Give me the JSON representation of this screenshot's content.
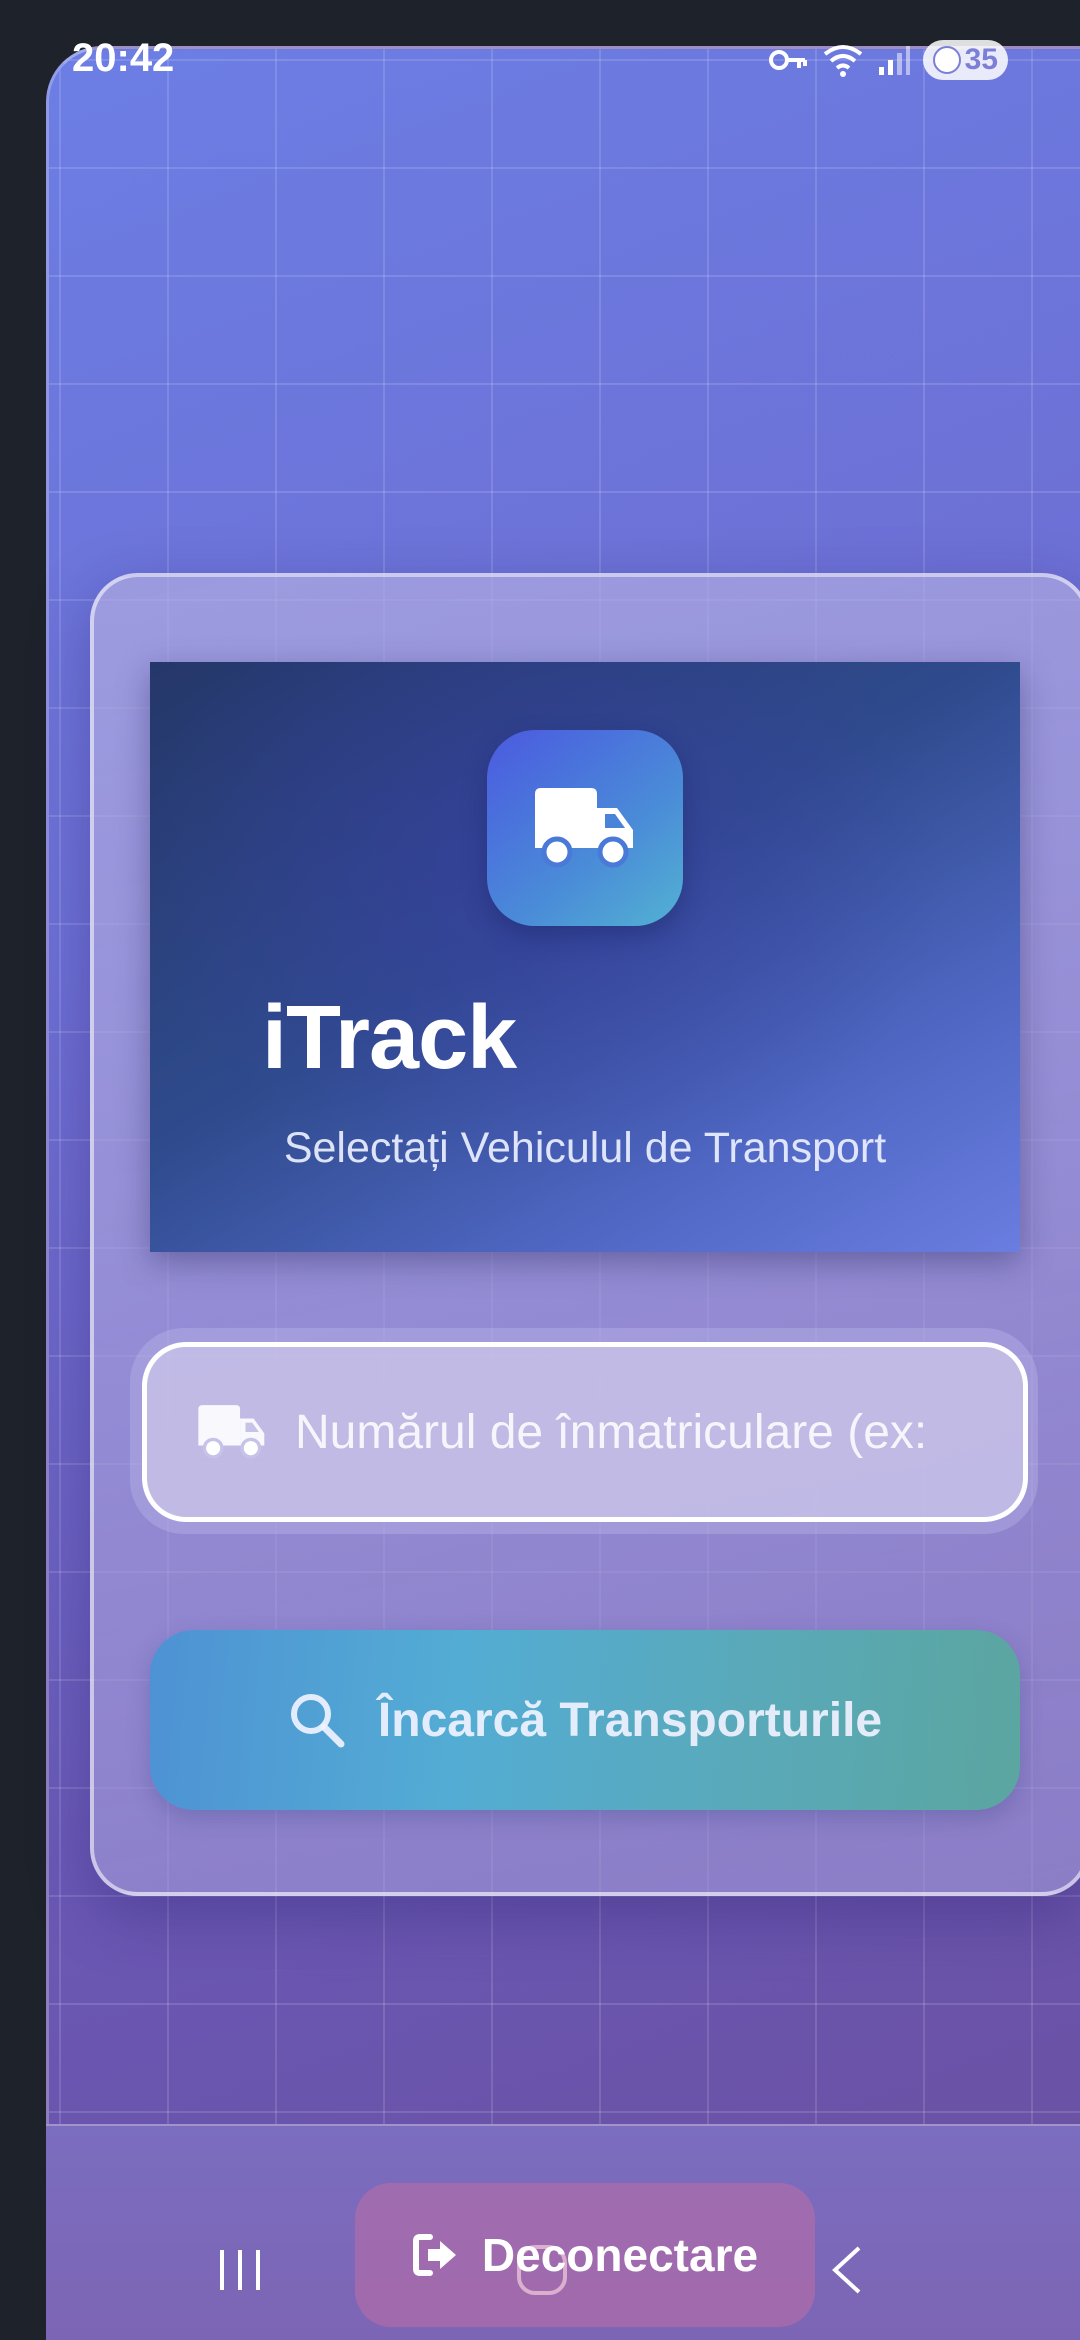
{
  "status_bar": {
    "time": "20:42",
    "battery": "35",
    "icons": [
      "key-icon",
      "wifi-icon",
      "signal-icon",
      "battery-icon"
    ]
  },
  "hero": {
    "icon": "truck-icon",
    "title": "iTrack",
    "subtitle": "Selectați Vehiculul de Transport"
  },
  "plate_input": {
    "icon": "truck-icon",
    "placeholder": "Numărul de înmatriculare (ex:",
    "value": ""
  },
  "load_button": {
    "icon": "search-icon",
    "label": "Încarcă Transporturile"
  },
  "logout_button": {
    "icon": "logout-icon",
    "label": "Deconectare"
  },
  "navigation": {
    "recents": "recents-icon",
    "home": "home-icon",
    "back": "back-icon"
  },
  "colors": {
    "hero_dark": "#25376a",
    "logo_gradient_start": "#4b5ae0",
    "button_gradient_start": "#4e92d4",
    "button_gradient_end": "#5ba6a0"
  }
}
